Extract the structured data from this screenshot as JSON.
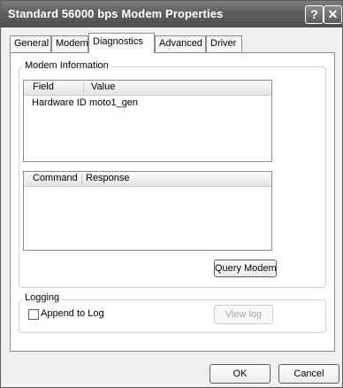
{
  "window": {
    "title": "Standard 56000 bps Modem Properties",
    "help_glyph": "?",
    "close_glyph": "✕"
  },
  "tabs": [
    {
      "label": "General",
      "active": false
    },
    {
      "label": "Modem",
      "active": false
    },
    {
      "label": "Diagnostics",
      "active": true
    },
    {
      "label": "Advanced",
      "active": false
    },
    {
      "label": "Driver",
      "active": false
    }
  ],
  "modem_info": {
    "group_label": "Modem Information",
    "info_table": {
      "columns": [
        "Field",
        "Value"
      ],
      "rows": [
        {
          "field": "Hardware ID",
          "value": "moto1_gen"
        }
      ]
    },
    "command_table": {
      "columns": [
        "Command",
        "Response"
      ],
      "rows": []
    },
    "query_button": "Query Modem"
  },
  "logging": {
    "group_label": "Logging",
    "append_label": "Append to Log",
    "append_checked": false,
    "view_log_button": "View log"
  },
  "footer": {
    "ok": "OK",
    "cancel": "Cancel"
  }
}
